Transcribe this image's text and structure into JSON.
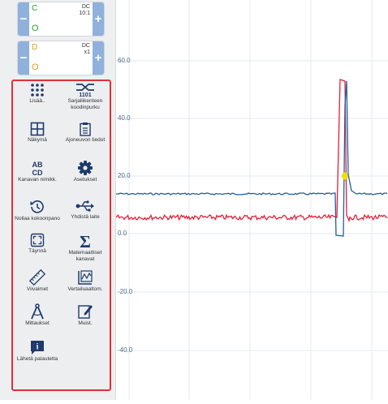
{
  "channels": [
    {
      "letter": "C",
      "coupling": "DC",
      "range": "10:1",
      "status": "O",
      "color": "#2aa02a"
    },
    {
      "letter": "D",
      "coupling": "DC",
      "range": "x1",
      "status": "O",
      "color": "#e39a1b"
    }
  ],
  "channel_buttons": {
    "minus": "−",
    "plus": "+"
  },
  "tools": [
    {
      "label": "Lisää..",
      "icon": "dots-grid-icon"
    },
    {
      "label": "Sarjaliikenteen koodinpurku",
      "icon": "serial-decoding-icon"
    },
    {
      "label": "Näkymä",
      "icon": "view-grid-icon"
    },
    {
      "label": "Ajoneuvon tiedot",
      "icon": "clipboard-icon"
    },
    {
      "label": "Kanavan nimikk.",
      "icon": "channel-labels-icon"
    },
    {
      "label": "Asetukset",
      "icon": "gear-icon"
    },
    {
      "label": "Nollaa kokoonpano",
      "icon": "reset-icon"
    },
    {
      "label": "Yhdistä laite",
      "icon": "usb-icon"
    },
    {
      "label": "Täynnä",
      "icon": "fullscreen-icon"
    },
    {
      "label": "Matemaattiset kanavat",
      "icon": "sigma-icon"
    },
    {
      "label": "Viivaimet",
      "icon": "ruler-icon"
    },
    {
      "label": "Vertailuaaltom.",
      "icon": "reference-waveform-icon"
    },
    {
      "label": "Mittaukset",
      "icon": "compass-icon"
    },
    {
      "label": "Muist.",
      "icon": "notes-icon"
    },
    {
      "label": "Lähetä palautetta",
      "icon": "feedback-icon"
    }
  ],
  "icon_glyphs": {
    "abcd_top": "AB",
    "abcd_bottom": "CD",
    "serial_digits": "1101",
    "info": "i",
    "sigma": "Σ"
  },
  "graph": {
    "y_ticks": [
      "60.0",
      "40.0",
      "20.0",
      "0.0",
      "-20.0",
      "-40.0"
    ]
  },
  "colors": {
    "accent": "#8fb1dc",
    "menu_border": "#e0303a",
    "icon_navy": "#1f3a6b",
    "trace_blue": "#1f5fa0",
    "trace_red": "#e3203a",
    "trigger_marker": "#f5e000"
  }
}
